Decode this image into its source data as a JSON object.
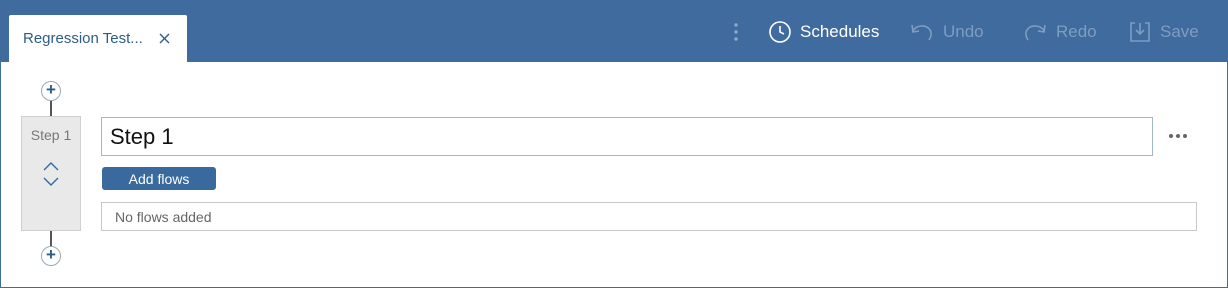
{
  "tab": {
    "label": "Regression Test...",
    "close_icon": "close-icon"
  },
  "toolbar": {
    "more_icon": "vertical-dots-icon",
    "schedules": {
      "label": "Schedules",
      "icon": "clock-icon",
      "enabled": true
    },
    "undo": {
      "label": "Undo",
      "icon": "undo-icon",
      "enabled": false
    },
    "redo": {
      "label": "Redo",
      "icon": "redo-icon",
      "enabled": false
    },
    "save": {
      "label": "Save",
      "icon": "save-icon",
      "enabled": false
    }
  },
  "steps": [
    {
      "card_label": "Step 1",
      "name_value": "Step 1",
      "add_flows_label": "Add flows",
      "flows_empty_text": "No flows added"
    }
  ],
  "colors": {
    "header": "#3f6b9f",
    "accent": "#3a6a9d",
    "disabled_text": "#7f9dc0"
  }
}
